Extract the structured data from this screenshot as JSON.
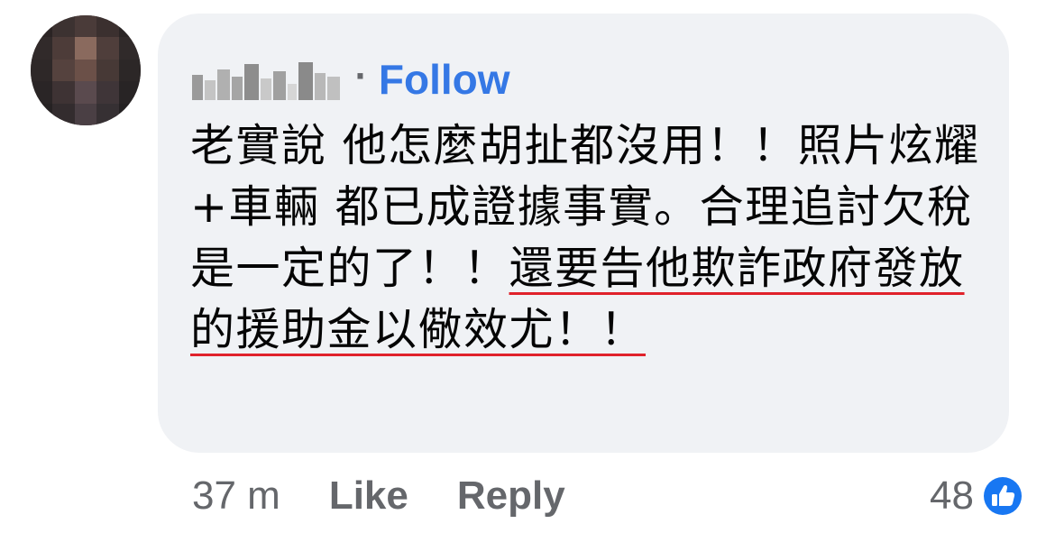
{
  "comment": {
    "author_name": "",
    "separator": "·",
    "follow_label": "Follow",
    "text_part1": "老實說 他怎麼胡扯都沒用！！照片炫耀+車輛 都已成證據事實。合理追討欠稅是一定的了！！",
    "text_part2_underlined": "還要告他欺詐政府發放的援助金以儆效尤！！",
    "timestamp": "37 m",
    "like_label": "Like",
    "reply_label": "Reply",
    "reaction_count": "48"
  },
  "colors": {
    "bubble": "#f0f2f5",
    "follow": "#3578e5",
    "meta_text": "#65676b",
    "underline": "#e0222b",
    "like_icon": "#1877f2"
  },
  "icons": {
    "reaction": "like-thumbs-up-icon"
  }
}
